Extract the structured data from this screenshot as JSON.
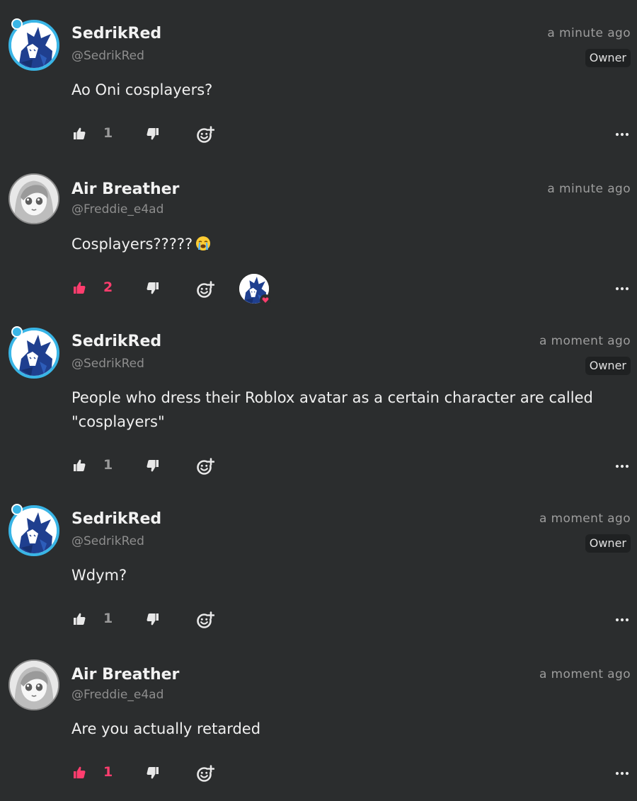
{
  "colors": {
    "background": "#2b2d2e",
    "like_active": "#ff3d6e",
    "owner_ring": "#39b5e6",
    "muted_text": "#8d8d8d"
  },
  "icons": {
    "like": "thumbs-up-icon",
    "dislike": "thumbs-down-icon",
    "react": "add-reaction-icon",
    "more": "more-options-icon"
  },
  "comments": [
    {
      "display_name": "SedrikRed",
      "handle": "@SedrikRed",
      "timestamp": "a minute ago",
      "badge": "Owner",
      "text": "Ao Oni cosplayers?",
      "likes": "1",
      "liked": false
    },
    {
      "display_name": "Air Breather",
      "handle": "@Freddie_e4ad",
      "timestamp": "a minute ago",
      "text": "Cosplayers?????",
      "emoji": "loudly-crying-face",
      "likes": "2",
      "liked": true,
      "reaction_by": "SedrikRed"
    },
    {
      "display_name": "SedrikRed",
      "handle": "@SedrikRed",
      "timestamp": "a moment ago",
      "badge": "Owner",
      "text": "People who dress their Roblox avatar as a certain character are called \"cosplayers\"",
      "likes": "1",
      "liked": false
    },
    {
      "display_name": "SedrikRed",
      "handle": "@SedrikRed",
      "timestamp": "a moment ago",
      "badge": "Owner",
      "text": "Wdym?",
      "likes": "1",
      "liked": false
    },
    {
      "display_name": "Air Breather",
      "handle": "@Freddie_e4ad",
      "timestamp": "a moment ago",
      "text": "Are you actually retarded",
      "likes": "1",
      "liked": true
    }
  ]
}
